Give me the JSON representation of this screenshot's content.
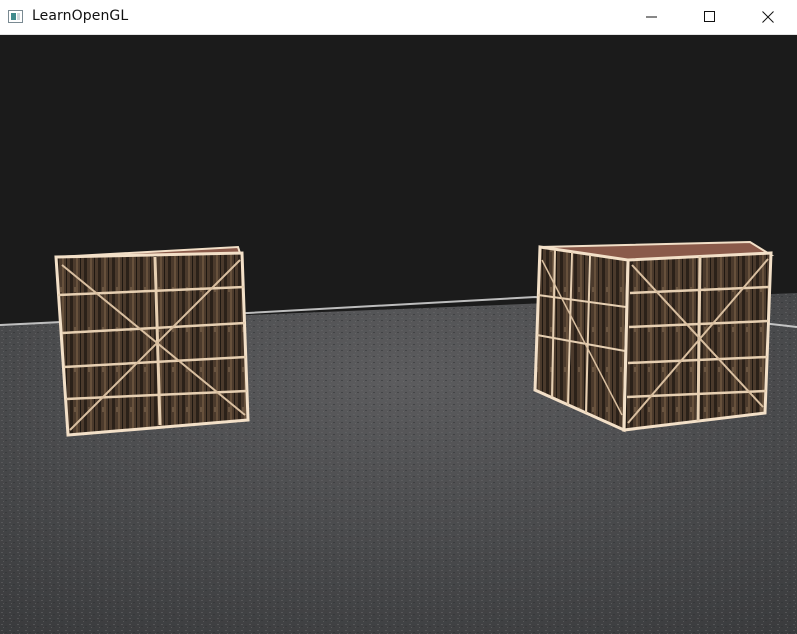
{
  "window": {
    "title": "LearnOpenGL",
    "controls": {
      "minimize_icon": "minimize-icon",
      "maximize_icon": "maximize-icon",
      "close_icon": "close-icon"
    }
  },
  "scene": {
    "background_color": "#1b1b1b",
    "floor_color": "#4b4b4c",
    "crate_wood_color": "#4a3a2c",
    "crate_edge_color": "#f3e0c8",
    "objects": [
      "floor-plane",
      "crate-left",
      "crate-right"
    ]
  }
}
